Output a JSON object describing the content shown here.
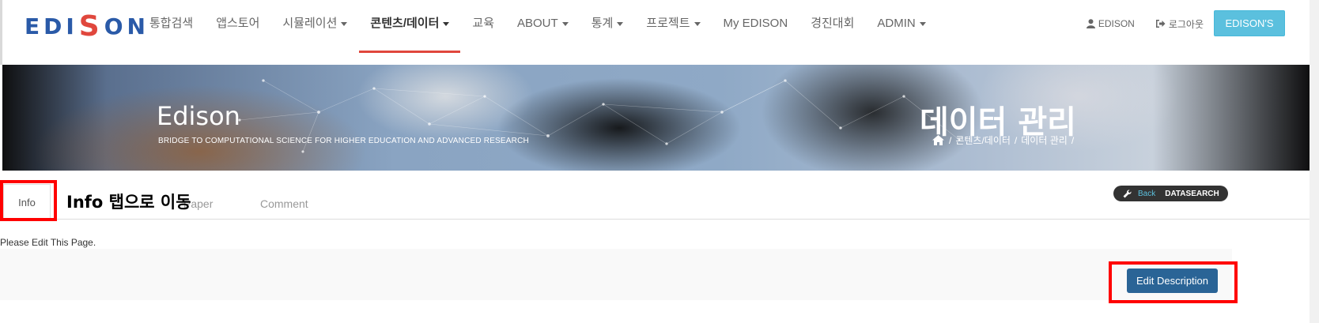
{
  "nav": {
    "logo_left": "EDI",
    "logo_s": "S",
    "logo_right": "ON",
    "items": [
      {
        "label": "통합검색",
        "dropdown": false
      },
      {
        "label": "앱스토어",
        "dropdown": false
      },
      {
        "label": "시뮬레이션",
        "dropdown": true
      },
      {
        "label": "콘텐츠/데이터",
        "dropdown": true,
        "active": true
      },
      {
        "label": "교육",
        "dropdown": false
      },
      {
        "label": "ABOUT",
        "dropdown": true
      },
      {
        "label": "통계",
        "dropdown": true
      },
      {
        "label": "프로젝트",
        "dropdown": true
      },
      {
        "label": "My EDISON",
        "dropdown": false
      },
      {
        "label": "경진대회",
        "dropdown": false
      },
      {
        "label": "ADMIN",
        "dropdown": true
      }
    ],
    "user_label": "EDISON",
    "user_icon": "user-icon",
    "logout_label": "로그아웃",
    "logout_icon": "sign-out-icon",
    "brand_button": "EDISON'S"
  },
  "banner": {
    "title": "Edison",
    "subtitle": "BRIDGE TO COMPUTATIONAL SCIENCE FOR HIGHER EDUCATION AND ADVANCED RESEARCH",
    "heading": "데이터 관리",
    "breadcrumb": [
      "콘텐츠/데이터",
      "데이터 관리"
    ],
    "home_icon": "home-icon"
  },
  "tabs": {
    "items": [
      "Info",
      "Paper",
      "Comment"
    ],
    "annotation": "Info 탭으로 이동"
  },
  "tools": {
    "back_label": "Back",
    "datasearch_label": "DATASEARCH",
    "wrench_icon": "wrench-icon"
  },
  "content": {
    "message": "Please Edit This Page.",
    "edit_button": "Edit Description"
  },
  "colors": {
    "active_underline": "#e0473d",
    "brand_button": "#5bc0de",
    "edit_button": "#2a6496",
    "highlight": "#ff0000"
  }
}
